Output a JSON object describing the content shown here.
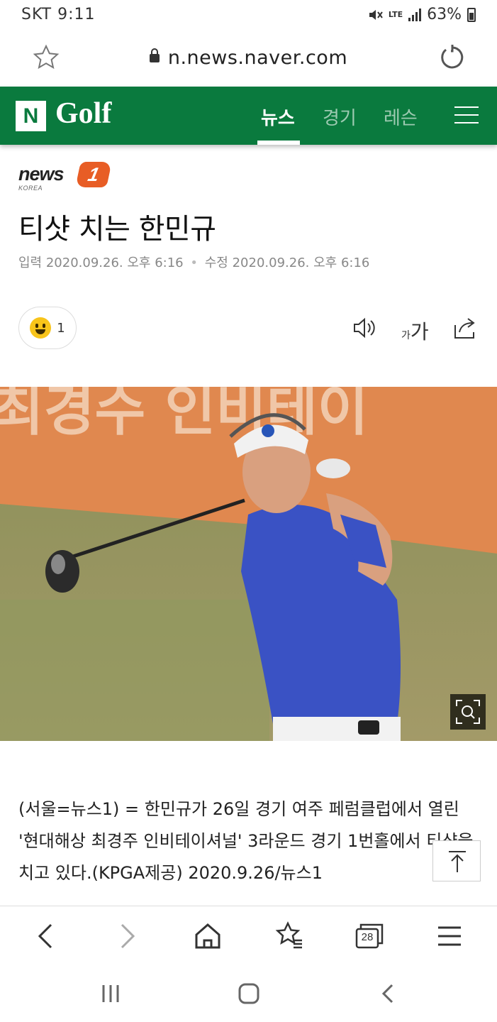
{
  "status": {
    "carrier": "SKT",
    "time": "9:11",
    "network": "LTE",
    "battery": "63%"
  },
  "browser": {
    "url": "n.news.naver.com",
    "tab_count": "28"
  },
  "site": {
    "logo_letter": "N",
    "title": "Golf",
    "tabs": [
      {
        "label": "뉴스",
        "active": true
      },
      {
        "label": "경기",
        "active": false
      },
      {
        "label": "레슨",
        "active": false
      }
    ]
  },
  "article": {
    "press": {
      "name": "news",
      "number": "1",
      "sub": "KOREA"
    },
    "headline": "티샷 치는 한민규",
    "published_label": "입력",
    "published": "2020.09.26. 오후 6:16",
    "modified_label": "수정",
    "modified": "2020.09.26. 오후 6:16",
    "reaction_count": "1",
    "fontsize_small": "가",
    "fontsize_large": "가",
    "photo_banner_text": "최경수 인비테이",
    "caption": "(서울=뉴스1) = 한민규가 26일 경기 여주 페럼클럽에서 열린 '현대해상 최경주 인비테이셔널' 3라운드 경기 1번홀에서 티샷을 치고 있다.(KPGA제공) 2020.9.26/뉴스1"
  },
  "colors": {
    "brand_green": "#0a7a3e",
    "press_orange": "#e85d25"
  }
}
